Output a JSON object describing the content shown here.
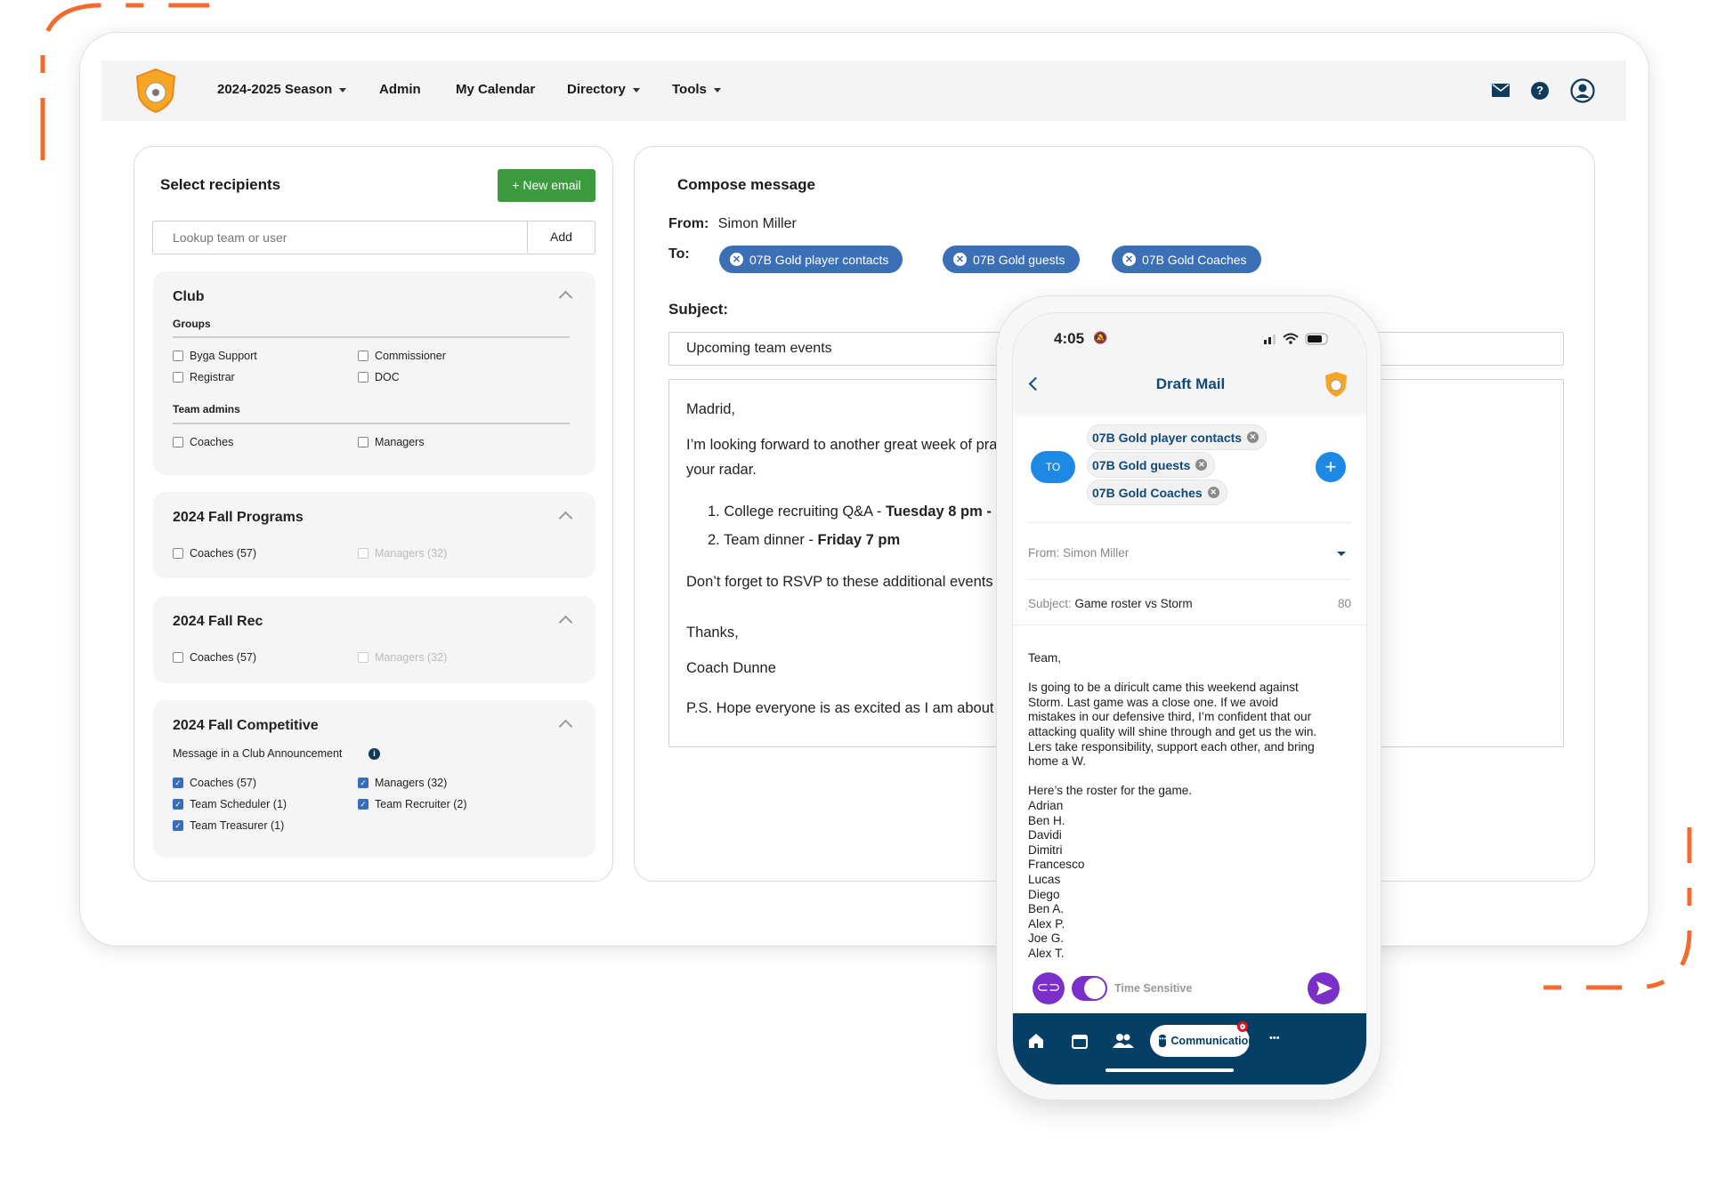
{
  "colors": {
    "accent_orange": "#f26a2e",
    "button_green": "#3c9a3f",
    "chip_blue": "#3b6fb6",
    "navy": "#063f66",
    "purple": "#7b2fc9",
    "phone_blue": "#1e88e5"
  },
  "nav": {
    "items": [
      {
        "label": "2024-2025 Season",
        "dropdown": true
      },
      {
        "label": "Admin"
      },
      {
        "label": "My Calendar"
      },
      {
        "label": "Directory",
        "dropdown": true
      },
      {
        "label": "Tools",
        "dropdown": true
      }
    ],
    "icons": [
      "mail-icon",
      "help-icon",
      "user-icon"
    ],
    "help_glyph": "?"
  },
  "recipients": {
    "title": "Select recipients",
    "new_email": "+ New email",
    "lookup_placeholder": "Lookup team or user",
    "add": "Add",
    "club": {
      "title": "Club",
      "groups_label": "Groups",
      "groups": [
        "Byga Support",
        "Commissioner",
        "Registrar",
        "DOC"
      ],
      "admins_label": "Team admins",
      "admins": [
        "Coaches",
        "Managers"
      ]
    },
    "fall_programs": {
      "title": "2024 Fall Programs",
      "coaches": "Coaches (57)",
      "managers": "Managers (32)"
    },
    "fall_rec": {
      "title": "2024 Fall Rec",
      "coaches": "Coaches (57)",
      "managers": "Managers (32)"
    },
    "fall_competitive": {
      "title": "2024 Fall Competitive",
      "announcement": "Message in a Club Announcement",
      "info_glyph": "i",
      "items": [
        "Coaches (57)",
        "Managers (32)",
        "Team Scheduler (1)",
        "Team Recruiter (2)",
        "Team Treasurer (1)"
      ]
    }
  },
  "compose": {
    "title": "Compose message",
    "from_label": "From:",
    "from": "Simon Miller",
    "to_label": "To:",
    "to": [
      "07B Gold player contacts",
      "07B Gold guests",
      "07B Gold Coaches"
    ],
    "chip_remove_glyph": "✕",
    "subject_label": "Subject:",
    "subject": "Upcoming team events",
    "body": {
      "greeting": "Madrid,",
      "line1": "I’m looking forward to another great week of pra",
      "line2": "your radar.",
      "item1_a": "1.  College recruiting Q&A - ",
      "item1_b": "Tuesday 8 pm - 9",
      "item2_a": "2.  Team dinner - ",
      "item2_b": "Friday 7 pm",
      "rsvp": "Don’t forget to RSVP to these additional events",
      "thanks": "Thanks,",
      "sign": "Coach Dunne",
      "ps": "P.S. Hope everyone is as excited as I am about  th"
    }
  },
  "phone": {
    "time": "4:05",
    "title": "Draft Mail",
    "to_button": "TO",
    "plus_glyph": "+",
    "chips": [
      "07B Gold player contacts",
      "07B Gold guests",
      "07B Gold Coaches"
    ],
    "chip_remove_glyph": "✕",
    "from": "From: Simon Miller",
    "subject_label": "Subject:",
    "subject": "Game roster vs Storm",
    "subject_count": "80",
    "body": "Team,\n\nIs going to be a diricult came this weekend against\nStorm. Last game was a close one. If we avoid\nmistakes in our defensive third, I’m confident that our\nattacking quality will shine through and get us the win.\nLers take responsibility, support each other, and bring\nhome a W.\n\nHere’s the roster for the game.\nAdrian\nBen H.\nDavidi\nDimitri\nFrancesco\nLucas\nDiego\nBen A.\nAlex P.\nJoe G.\nAlex T.",
    "time_sensitive": "Time Sensitive",
    "time_sensitive_on": true,
    "tabs": [
      "home-icon",
      "calendar-icon",
      "people-icon",
      "Communication",
      "more-icon"
    ],
    "active_tab": "Communication",
    "more_glyph": "•••"
  }
}
